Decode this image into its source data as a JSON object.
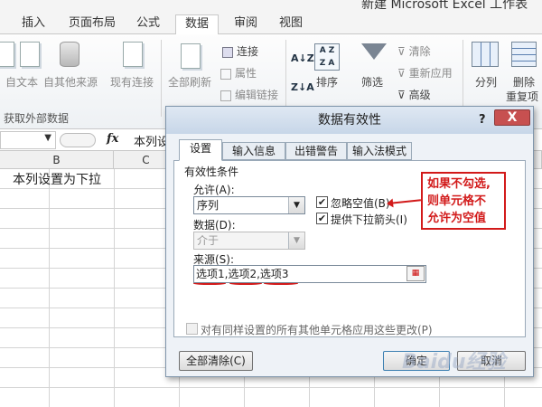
{
  "window": {
    "title": "新建 Microsoft Excel 工作表"
  },
  "ribbon_tabs": [
    "插入",
    "页面布局",
    "公式",
    "数据",
    "审阅",
    "视图"
  ],
  "ribbon": {
    "from_text": "自文本",
    "from_other": "自其他来源",
    "existing_conn": "现有连接",
    "refresh_all": "全部刷新",
    "connections": "连接",
    "properties": "属性",
    "edit_links": "编辑链接",
    "sort": "排序",
    "filter": "筛选",
    "clear": "清除",
    "reapply": "重新应用",
    "advanced": "高级",
    "split": "分列",
    "remove": "删除",
    "remove2": "重复项",
    "group_external": "获取外部数据"
  },
  "formula_bar": {
    "fx": "fx",
    "content": "本列设"
  },
  "columns": [
    "B",
    "C"
  ],
  "cell_a1": "本列设置为下拉",
  "dialog": {
    "title": "数据有效性",
    "help": "?",
    "close": "X",
    "tabs": [
      "设置",
      "输入信息",
      "出错警告",
      "输入法模式"
    ],
    "section_title": "有效性条件",
    "allow_label": "允许(A):",
    "allow_value": "序列",
    "data_label": "数据(D):",
    "data_value": "介于",
    "ignore_blank": "忽略空值(B)",
    "ignore_blank_checked": true,
    "dropdown_arrow": "提供下拉箭头(I)",
    "dropdown_arrow_checked": true,
    "source_label": "来源(S):",
    "source_value": "选项1,选项2,选项3",
    "apply_all": "对有同样设置的所有其他单元格应用这些更改(P)",
    "clear_all": "全部清除(C)",
    "ok": "确定",
    "cancel": "取消"
  },
  "annotation": {
    "line1": "如果不勾选,",
    "line2": "则单元格不",
    "line3": "允许为空值",
    "color": "#d21a1a"
  },
  "watermark": "Baidu经验"
}
